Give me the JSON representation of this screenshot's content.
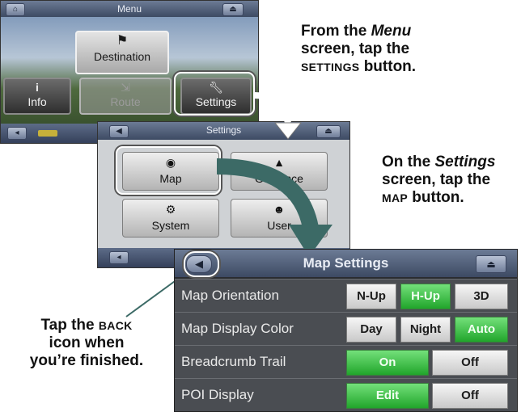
{
  "menu_screen": {
    "title": "Menu",
    "buttons": {
      "destination": "Destination",
      "info": "Info",
      "route": "Route",
      "settings": "Settings"
    }
  },
  "settings_screen": {
    "title": "Settings",
    "buttons": {
      "map": "Map",
      "guidance": "Guidance",
      "system": "System",
      "user": "User"
    }
  },
  "map_settings": {
    "title": "Map Settings",
    "rows": [
      {
        "label": "Map Orientation",
        "options": [
          "N-Up",
          "H-Up",
          "3D"
        ],
        "selected": "H-Up"
      },
      {
        "label": "Map Display Color",
        "options": [
          "Day",
          "Night",
          "Auto"
        ],
        "selected": "Auto"
      },
      {
        "label": "Breadcrumb Trail",
        "options": [
          "On",
          "Off"
        ],
        "selected": "On"
      },
      {
        "label": "POI Display",
        "options": [
          "Edit",
          "Off"
        ],
        "selected": "Edit"
      }
    ]
  },
  "captions": {
    "step1": {
      "line1_a": "From the ",
      "line1_em": "Menu",
      "line2": "screen, tap the",
      "line3_sc": "SETTINGS",
      "line3_b": " button."
    },
    "step2": {
      "line1_a": "On the ",
      "line1_em": "Settings",
      "line2": "screen, tap the",
      "line3_sc": "MAP",
      "line3_b": " button."
    },
    "step3": {
      "line1_a": "Tap the ",
      "line1_sc": "BACK",
      "line2": "icon when",
      "line3": "you’re finished."
    }
  },
  "colors": {
    "selected": "#2fb83a",
    "callout": "#ffffff",
    "arrow": "#3c6a66"
  }
}
